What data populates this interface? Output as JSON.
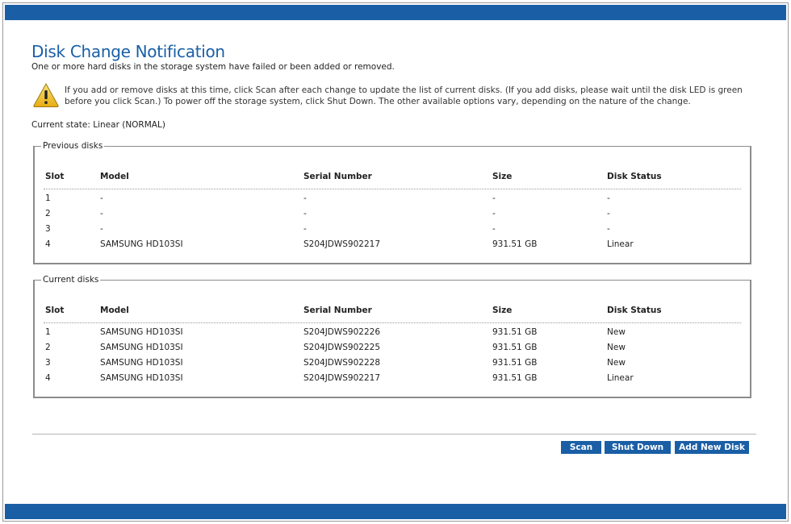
{
  "page": {
    "title": "Disk Change Notification",
    "subtitle": "One or more hard disks in the storage system have failed or been added or removed.",
    "warning_icon": "warning-triangle-icon",
    "warning_text": "If you add or remove disks at this time, click Scan after each change to update the list of current disks. (If you add disks, please wait until the disk LED is green before you click Scan.) To power off the storage system, click Shut Down. The other available options vary, depending on the nature of the change.",
    "current_state": "Current state: Linear (NORMAL)"
  },
  "columns": {
    "slot": "Slot",
    "model": "Model",
    "serial": "Serial Number",
    "size": "Size",
    "status": "Disk Status"
  },
  "previous": {
    "legend": "Previous disks",
    "rows": [
      {
        "slot": "1",
        "model": "-",
        "serial": "-",
        "size": "-",
        "status": "-"
      },
      {
        "slot": "2",
        "model": "-",
        "serial": "-",
        "size": "-",
        "status": "-"
      },
      {
        "slot": "3",
        "model": "-",
        "serial": "-",
        "size": "-",
        "status": "-"
      },
      {
        "slot": "4",
        "model": "SAMSUNG HD103SI",
        "serial": "S204JDWS902217",
        "size": "931.51 GB",
        "status": "Linear"
      }
    ]
  },
  "current": {
    "legend": "Current disks",
    "rows": [
      {
        "slot": "1",
        "model": "SAMSUNG HD103SI",
        "serial": "S204JDWS902226",
        "size": "931.51 GB",
        "status": "New"
      },
      {
        "slot": "2",
        "model": "SAMSUNG HD103SI",
        "serial": "S204JDWS902225",
        "size": "931.51 GB",
        "status": "New"
      },
      {
        "slot": "3",
        "model": "SAMSUNG HD103SI",
        "serial": "S204JDWS902228",
        "size": "931.51 GB",
        "status": "New"
      },
      {
        "slot": "4",
        "model": "SAMSUNG HD103SI",
        "serial": "S204JDWS902217",
        "size": "931.51 GB",
        "status": "Linear"
      }
    ]
  },
  "buttons": {
    "scan": "Scan",
    "shutdown": "Shut Down",
    "add_new_disk": "Add New Disk"
  },
  "colors": {
    "brand_blue": "#1a5fa6",
    "warning_yellow": "#f3c531"
  }
}
